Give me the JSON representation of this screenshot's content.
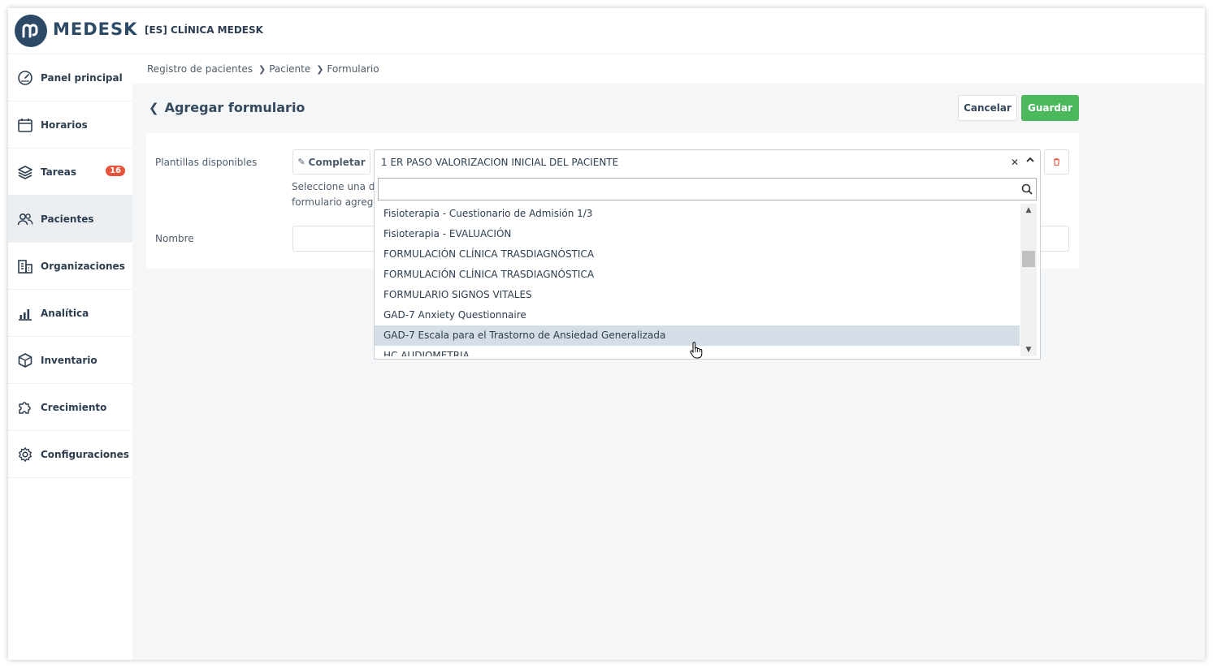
{
  "app": {
    "brand": "MEDESK",
    "clinic": "[ES] CLÍNICA MEDESK"
  },
  "sidebar": {
    "items": [
      {
        "label": "Panel principal",
        "icon": "dashboard-gauge-icon"
      },
      {
        "label": "Horarios",
        "icon": "calendar-icon"
      },
      {
        "label": "Tareas",
        "icon": "layers-icon",
        "badge": "16"
      },
      {
        "label": "Pacientes",
        "icon": "users-icon",
        "active": true
      },
      {
        "label": "Organizaciones",
        "icon": "building-icon"
      },
      {
        "label": "Analítica",
        "icon": "bar-chart-icon"
      },
      {
        "label": "Inventario",
        "icon": "box-icon"
      },
      {
        "label": "Crecimiento",
        "icon": "puzzle-icon"
      },
      {
        "label": "Configuraciones",
        "icon": "gear-icon"
      }
    ]
  },
  "breadcrumb": {
    "items": [
      "Registro de pacientes",
      "Paciente",
      "Formulario"
    ]
  },
  "page": {
    "title": "Agregar formulario",
    "cancel_label": "Cancelar",
    "save_label": "Guardar"
  },
  "form": {
    "templates_label": "Plantillas disponibles",
    "complete_label": "Completar",
    "help_line1": "Seleccione una de",
    "help_line2": "formulario agrega",
    "name_label": "Nombre",
    "name_value": ""
  },
  "select": {
    "value": "1 ER PASO VALORIZACION INICIAL DEL PACIENTE",
    "search_value": "",
    "options": [
      "Fisioterapia - Cuestionario de Admisión 1/3",
      "Fisioterapia - EVALUACIÓN",
      "FORMULACIÓN CLÍNICA TRASDIAGNÓSTICA",
      "FORMULACIÓN CLÍNICA TRASDIAGNÓSTICA",
      "FORMULARIO SIGNOS VITALES",
      "GAD-7 Anxiety Questionnaire",
      "GAD-7 Escala para el Trastorno de Ansiedad Generalizada",
      "HC AUDIOMETRIA"
    ],
    "hovered_index": 6
  },
  "colors": {
    "primary": "#2c4a66",
    "save_green": "#4cb85c",
    "badge_red": "#e6533c",
    "hover_row": "#d5dde6",
    "content_bg": "#f4f6f8"
  }
}
